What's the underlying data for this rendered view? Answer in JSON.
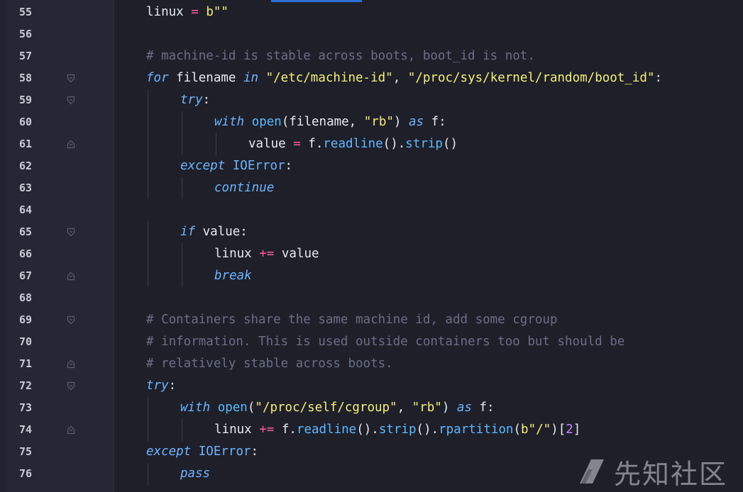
{
  "editor": {
    "lines": [
      {
        "n": "55",
        "indent": 0,
        "fold": "",
        "tokens": [
          [
            "t",
            "linux "
          ],
          [
            "op",
            "="
          ],
          [
            "t",
            " "
          ],
          [
            "str",
            "b\"\""
          ]
        ]
      },
      {
        "n": "56",
        "indent": 0,
        "fold": "",
        "tokens": []
      },
      {
        "n": "57",
        "indent": 0,
        "fold": "",
        "tokens": [
          [
            "cm",
            "# machine-id is stable across boots, boot_id is not."
          ]
        ]
      },
      {
        "n": "58",
        "indent": 0,
        "fold": "down",
        "tokens": [
          [
            "kw",
            "for"
          ],
          [
            "t",
            " filename "
          ],
          [
            "kw",
            "in"
          ],
          [
            "t",
            " "
          ],
          [
            "str",
            "\"/etc/machine-id\""
          ],
          [
            "t",
            ", "
          ],
          [
            "str",
            "\"/proc/sys/kernel/random/boot_id\""
          ],
          [
            "t",
            ":"
          ]
        ]
      },
      {
        "n": "59",
        "indent": 1,
        "fold": "down",
        "tokens": [
          [
            "kw",
            "try"
          ],
          [
            "t",
            ":"
          ]
        ]
      },
      {
        "n": "60",
        "indent": 2,
        "fold": "",
        "tokens": [
          [
            "kw",
            "with"
          ],
          [
            "t",
            " "
          ],
          [
            "fn",
            "open"
          ],
          [
            "t",
            "(filename, "
          ],
          [
            "str",
            "\"rb\""
          ],
          [
            "t",
            ") "
          ],
          [
            "kw",
            "as"
          ],
          [
            "t",
            " f:"
          ]
        ]
      },
      {
        "n": "61",
        "indent": 3,
        "fold": "up",
        "tokens": [
          [
            "t",
            "value "
          ],
          [
            "op",
            "="
          ],
          [
            "t",
            " f."
          ],
          [
            "fn",
            "readline"
          ],
          [
            "t",
            "()."
          ],
          [
            "fn",
            "strip"
          ],
          [
            "t",
            "()"
          ]
        ]
      },
      {
        "n": "62",
        "indent": 1,
        "fold": "",
        "tokens": [
          [
            "kw",
            "except"
          ],
          [
            "t",
            " "
          ],
          [
            "ex",
            "IOError"
          ],
          [
            "t",
            ":"
          ]
        ]
      },
      {
        "n": "63",
        "indent": 2,
        "fold": "",
        "tokens": [
          [
            "kw",
            "continue"
          ]
        ]
      },
      {
        "n": "64",
        "indent": 0,
        "fold": "",
        "tokens": []
      },
      {
        "n": "65",
        "indent": 1,
        "fold": "down",
        "tokens": [
          [
            "kw",
            "if"
          ],
          [
            "t",
            " value:"
          ]
        ]
      },
      {
        "n": "66",
        "indent": 2,
        "fold": "",
        "tokens": [
          [
            "t",
            "linux "
          ],
          [
            "op",
            "+="
          ],
          [
            "t",
            " value"
          ]
        ]
      },
      {
        "n": "67",
        "indent": 2,
        "fold": "up",
        "tokens": [
          [
            "kw",
            "break"
          ]
        ]
      },
      {
        "n": "68",
        "indent": 0,
        "fold": "",
        "tokens": []
      },
      {
        "n": "69",
        "indent": 0,
        "fold": "down",
        "tokens": [
          [
            "cm",
            "# Containers share the same machine id, add some cgroup"
          ]
        ]
      },
      {
        "n": "70",
        "indent": 0,
        "fold": "",
        "tokens": [
          [
            "cm",
            "# information. This is used outside containers too but should be"
          ]
        ]
      },
      {
        "n": "71",
        "indent": 0,
        "fold": "up",
        "tokens": [
          [
            "cm",
            "# relatively stable across boots."
          ]
        ]
      },
      {
        "n": "72",
        "indent": 0,
        "fold": "down",
        "tokens": [
          [
            "kw",
            "try"
          ],
          [
            "t",
            ":"
          ]
        ]
      },
      {
        "n": "73",
        "indent": 1,
        "fold": "",
        "tokens": [
          [
            "kw",
            "with"
          ],
          [
            "t",
            " "
          ],
          [
            "fn",
            "open"
          ],
          [
            "t",
            "("
          ],
          [
            "str",
            "\"/proc/self/cgroup\""
          ],
          [
            "t",
            ", "
          ],
          [
            "str",
            "\"rb\""
          ],
          [
            "t",
            ") "
          ],
          [
            "kw",
            "as"
          ],
          [
            "t",
            " f:"
          ]
        ]
      },
      {
        "n": "74",
        "indent": 2,
        "fold": "up",
        "tokens": [
          [
            "t",
            "linux "
          ],
          [
            "op",
            "+="
          ],
          [
            "t",
            " f."
          ],
          [
            "fn",
            "readline"
          ],
          [
            "t",
            "()."
          ],
          [
            "fn",
            "strip"
          ],
          [
            "t",
            "()."
          ],
          [
            "fn",
            "rpartition"
          ],
          [
            "t",
            "("
          ],
          [
            "str",
            "b\"/\""
          ],
          [
            "t",
            ")["
          ],
          [
            "num",
            "2"
          ],
          [
            "t",
            "]"
          ]
        ]
      },
      {
        "n": "75",
        "indent": 0,
        "fold": "",
        "tokens": [
          [
            "kw",
            "except"
          ],
          [
            "t",
            " "
          ],
          [
            "ex",
            "IOError"
          ],
          [
            "t",
            ":"
          ]
        ]
      },
      {
        "n": "76",
        "indent": 1,
        "fold": "",
        "tokens": [
          [
            "kw",
            "pass"
          ]
        ]
      }
    ]
  },
  "watermark": {
    "text": "先知社区",
    "icon": "xianzhi-logo-icon"
  },
  "colors": {
    "background": "#1e1f29",
    "keyword": "#6fb4ff",
    "string": "#f4f07a",
    "comment": "#6a6f86",
    "operator": "#ff5fa0",
    "number": "#c88bff"
  }
}
